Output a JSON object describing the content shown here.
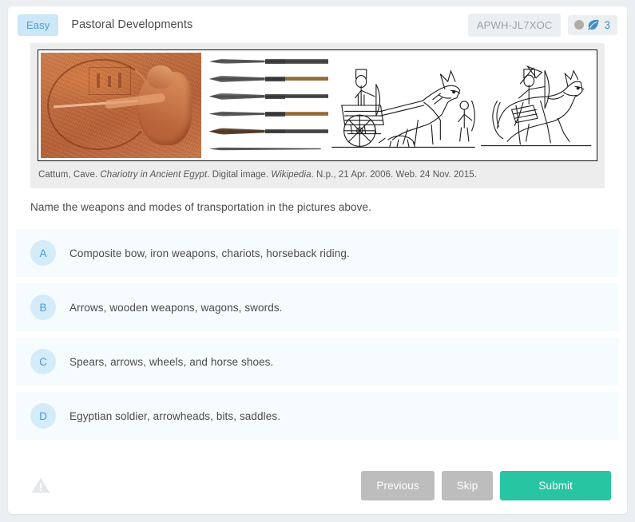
{
  "header": {
    "difficulty": "Easy",
    "title": "Pastoral Developments",
    "code": "APWH-JL7XOC",
    "points": "3",
    "dot_icon": "gray-circle-icon",
    "leaf_icon": "leaf-icon"
  },
  "figure": {
    "caption_author": "Cattum, Cave.",
    "caption_work": "Chariotry in Ancient Egypt",
    "caption_middle": ". Digital image. ",
    "caption_source": "Wikipedia",
    "caption_tail": ". N.p., 21 Apr. 2006. Web. 24 Nov. 2015.",
    "alt": "Composite image: Egyptian relief of an archer drawing a composite bow, a row of iron spear and arrow heads, a line drawing of a chariot drawn by a horse, and a line drawing of a mounted horseback rider."
  },
  "question": {
    "prompt": "Name the weapons and modes of transportation in the pictures above."
  },
  "options": [
    {
      "letter": "A",
      "text": "Composite bow, iron weapons, chariots, horseback riding."
    },
    {
      "letter": "B",
      "text": "Arrows, wooden weapons, wagons, swords."
    },
    {
      "letter": "C",
      "text": "Spears, arrows, wheels, and horse shoes."
    },
    {
      "letter": "D",
      "text": "Egyptian soldier, arrowheads, bits, saddles."
    }
  ],
  "footer": {
    "warning_icon": "warning-triangle-icon",
    "previous_label": "Previous",
    "skip_label": "Skip",
    "submit_label": "Submit"
  },
  "colors": {
    "page_bg": "#eceff1",
    "card_bg": "#ffffff",
    "accent_blue": "#4d9ad2",
    "badge_blue_bg": "#cbe7f8",
    "option_bg": "#f6fbfe",
    "option_circle_bg": "#d4ebfa",
    "submit_green": "#27c5a2",
    "secondary_gray": "#bdbdbd",
    "text_gray": "#4a4a4a",
    "muted_gray": "#9aa3a8"
  }
}
